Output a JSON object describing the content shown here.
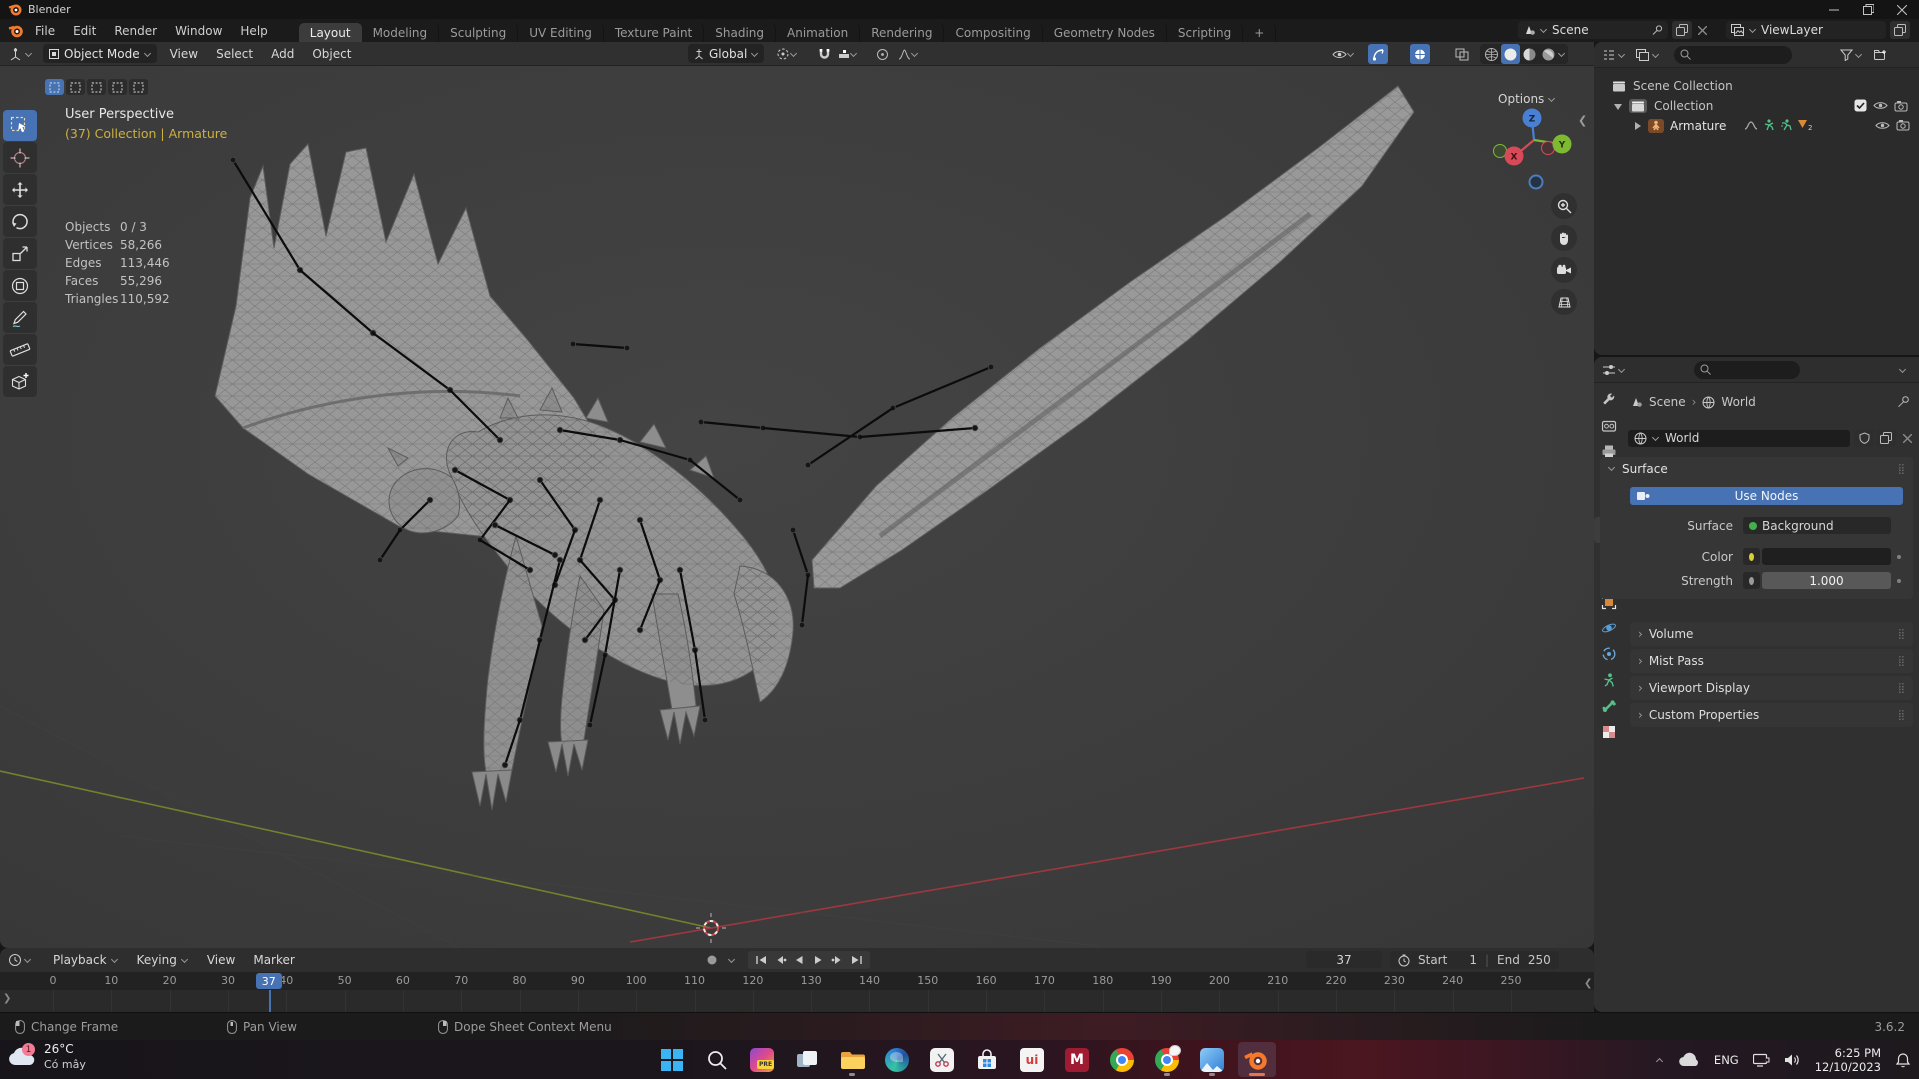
{
  "window": {
    "title": "Blender"
  },
  "menubar": {
    "menus": [
      "File",
      "Edit",
      "Render",
      "Window",
      "Help"
    ],
    "workspaces": [
      "Layout",
      "Modeling",
      "Sculpting",
      "UV Editing",
      "Texture Paint",
      "Shading",
      "Animation",
      "Rendering",
      "Compositing",
      "Geometry Nodes",
      "Scripting"
    ],
    "active_workspace": "Layout",
    "add_workspace_label": "+",
    "scene_value": "Scene",
    "view_layer_value": "ViewLayer"
  },
  "tool_header": {
    "mode": "Object Mode",
    "menus": [
      "View",
      "Select",
      "Add",
      "Object"
    ],
    "orientation": "Global"
  },
  "viewport": {
    "options_label": "Options",
    "info_view": "User Perspective",
    "info_context": "(37) Collection | Armature",
    "stats": [
      [
        "Objects",
        "0 / 3"
      ],
      [
        "Vertices",
        "58,266"
      ],
      [
        "Edges",
        "113,446"
      ],
      [
        "Faces",
        "55,296"
      ],
      [
        "Triangles",
        "110,592"
      ]
    ],
    "tools": [
      "select-box",
      "cursor",
      "move",
      "rotate",
      "scale",
      "transform",
      "annotate",
      "measure",
      "add-cube"
    ],
    "active_tool": "select-box",
    "select_modes": [
      "set",
      "extend",
      "subtract",
      "invert",
      "intersect"
    ],
    "gizmo": {
      "x": "X",
      "y": "Y",
      "z": "Z"
    }
  },
  "outliner": {
    "rows": {
      "scene_collection": "Scene Collection",
      "collection": "Collection",
      "armature": "Armature"
    }
  },
  "properties": {
    "tabs": [
      "tool",
      "render",
      "output",
      "view-layer",
      "scene",
      "world",
      "object",
      "physics",
      "constraints",
      "object-data",
      "bone",
      "texture"
    ],
    "active_tab": "world",
    "breadcrumb_scene": "Scene",
    "breadcrumb_world": "World",
    "datablock_name": "World",
    "surface_panel_title": "Surface",
    "use_nodes_label": "Use Nodes",
    "surface_row_label": "Surface",
    "surface_row_value": "Background",
    "color_label": "Color",
    "strength_label": "Strength",
    "strength_value": "1.000",
    "collapsed_panels": [
      "Volume",
      "Mist Pass",
      "Viewport Display",
      "Custom Properties"
    ]
  },
  "timeline": {
    "menus": [
      "Playback",
      "Keying",
      "View",
      "Marker"
    ],
    "transport": [
      "jump-start",
      "prev-keyframe",
      "play-reverse",
      "play",
      "next-keyframe",
      "jump-end"
    ],
    "current_frame": "37",
    "playhead_frame": 37,
    "start_label": "Start",
    "start_value": "1",
    "end_label": "End",
    "end_value": "250",
    "frame_ticks": [
      0,
      10,
      20,
      30,
      40,
      50,
      60,
      70,
      80,
      90,
      100,
      110,
      120,
      130,
      140,
      150,
      160,
      170,
      180,
      190,
      200,
      210,
      220,
      230,
      240,
      250
    ]
  },
  "status_bar": {
    "hints": [
      "Change Frame",
      "Pan View",
      "Dope Sheet Context Menu"
    ],
    "version": "3.6.2"
  },
  "taskbar": {
    "weather_temp": "26°C",
    "weather_condition": "Có mây",
    "weather_badge": "1",
    "apps": [
      "start",
      "search",
      "pre-app",
      "task-view",
      "file-explorer",
      "edge",
      "snipping-tool",
      "store",
      "unikey",
      "m-app",
      "chrome",
      "chrome-alt",
      "photos",
      "blender"
    ],
    "running_apps": [
      "file-explorer",
      "chrome-alt",
      "photos"
    ],
    "active_app": "blender",
    "tray_language": "ENG",
    "tray_time": "6:25 PM",
    "tray_date": "12/10/2023"
  },
  "colors": {
    "accent": "#4772b3",
    "context_yellow": "#cdb13f",
    "axis_x": "#a8383f",
    "axis_y": "#7a8f2a",
    "blender_orange": "#f5792a"
  }
}
